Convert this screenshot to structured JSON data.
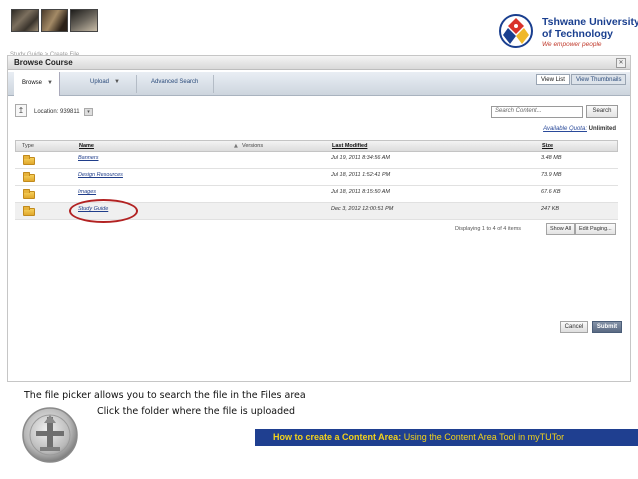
{
  "header": {
    "logo": {
      "line1": "Tshwane University",
      "line2": "of Technology",
      "tagline": "We empower people"
    }
  },
  "breadcrumb": "Study Guide > Create File",
  "window": {
    "title": "Browse Course",
    "nav": {
      "browse": "Browse",
      "upload": "Upload",
      "advanced_search": "Advanced Search",
      "view_list": "View List",
      "view_thumbnails": "View Thumbnails"
    },
    "location": {
      "label": "Location:",
      "value": "939811",
      "pill": "▾"
    },
    "search": {
      "placeholder": "Search Content...",
      "button": "Search"
    },
    "quota": {
      "label": "Available Quota:",
      "value": "Unlimited"
    },
    "table": {
      "headers": {
        "type": "Type",
        "name": "Name",
        "versions": "Versions",
        "modified": "Last Modified",
        "size": "Size"
      },
      "rows": [
        {
          "name": "Banners",
          "modified": "Jul 19, 2011 8:34:56 AM",
          "size": "3.48 MB"
        },
        {
          "name": "Design Resources",
          "modified": "Jul 18, 2011 1:52:41 PM",
          "size": "73.9 MB"
        },
        {
          "name": "Images",
          "modified": "Jul 18, 2011 8:15:50 AM",
          "size": "67.6 KB"
        },
        {
          "name": "Study Guide",
          "modified": "Dec 3, 2012 12:00:51 PM",
          "size": "247 KB"
        }
      ]
    },
    "paging": {
      "text": "Displaying 1 to 4 of 4 items",
      "show_all": "Show All",
      "edit_paging": "Edit Paging..."
    },
    "actions": {
      "cancel": "Cancel",
      "submit": "Submit"
    }
  },
  "captions": {
    "line1": "The file picker allows you to search the file in the Files area",
    "line2": "Click the folder where the file is uploaded"
  },
  "footer": {
    "bold": "How to create a Content Area:",
    "rest": " Using the Content Area Tool in myTUTor"
  },
  "colors": {
    "footer_bar": "#1f3f90",
    "footer_text": "#f2d21b",
    "highlight_ring": "#b22222",
    "link": "#1f3d8a"
  }
}
